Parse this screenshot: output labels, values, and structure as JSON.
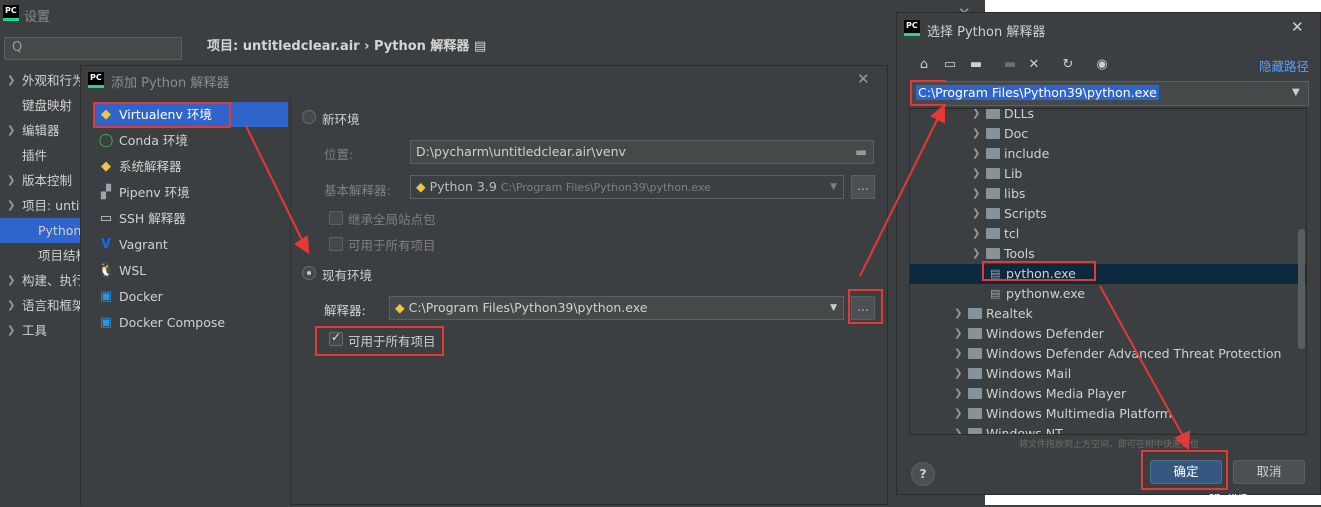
{
  "settings": {
    "title": "设置",
    "search_icon": "Q",
    "breadcrumb": "项目: untitledclear.air  ›  Python 解释器  ▤",
    "tree": [
      {
        "label": "外观和行为",
        "arrow": true
      },
      {
        "label": "键盘映射",
        "arrow": false
      },
      {
        "label": "编辑器",
        "arrow": true
      },
      {
        "label": "插件",
        "arrow": false
      },
      {
        "label": "版本控制",
        "arrow": true
      },
      {
        "label": "项目: untitledclear.air",
        "arrow": true
      },
      {
        "label": "Python 解释器",
        "arrow": false
      },
      {
        "label": "项目结构",
        "arrow": false
      },
      {
        "label": "构建、执行、部署",
        "arrow": true
      },
      {
        "label": "语言和框架",
        "arrow": true
      },
      {
        "label": "工具",
        "arrow": true
      }
    ]
  },
  "add_dialog": {
    "title": "添加 Python 解释器",
    "envs": [
      "Virtualenv 环境",
      "Conda 环境",
      "系统解释器",
      "Pipenv 环境",
      "SSH 解释器",
      "Vagrant",
      "WSL",
      "Docker",
      "Docker Compose"
    ],
    "new_env_label": "新环境",
    "location_label": "位置:",
    "location_value": "D:\\pycharm\\untitledclear.air\\venv",
    "base_interp_label": "基本解释器:",
    "base_interp_value": "Python 3.9",
    "base_interp_path": "C:\\Program Files\\Python39\\python.exe",
    "inherit_label": "继承全局站点包",
    "avail_all_label_1": "可用于所有项目",
    "existing_env_label": "现有环境",
    "interp_label": "解释器:",
    "interp_value": "C:\\Program Files\\Python39\\python.exe",
    "avail_all_label_2": "可用于所有项目",
    "browse": "..."
  },
  "chooser": {
    "title": "选择 Python 解释器",
    "hide_path": "隐藏路径",
    "path": "C:\\Program Files\\Python39\\python.exe",
    "nodes": [
      {
        "name": "DLLs",
        "type": "folder",
        "level": 1
      },
      {
        "name": "Doc",
        "type": "folder",
        "level": 1
      },
      {
        "name": "include",
        "type": "folder",
        "level": 1
      },
      {
        "name": "Lib",
        "type": "folder",
        "level": 1
      },
      {
        "name": "libs",
        "type": "folder",
        "level": 1
      },
      {
        "name": "Scripts",
        "type": "folder",
        "level": 1
      },
      {
        "name": "tcl",
        "type": "folder",
        "level": 1
      },
      {
        "name": "Tools",
        "type": "folder",
        "level": 1
      },
      {
        "name": "python.exe",
        "type": "file",
        "level": 1
      },
      {
        "name": "pythonw.exe",
        "type": "file",
        "level": 1
      },
      {
        "name": "Realtek",
        "type": "folder",
        "level": 0
      },
      {
        "name": "Windows Defender",
        "type": "folder",
        "level": 0
      },
      {
        "name": "Windows Defender Advanced Threat Protection",
        "type": "folder",
        "level": 0
      },
      {
        "name": "Windows Mail",
        "type": "folder",
        "level": 0
      },
      {
        "name": "Windows Media Player",
        "type": "folder",
        "level": 0
      },
      {
        "name": "Windows Multimedia Platform",
        "type": "folder",
        "level": 0
      },
      {
        "name": "Windows NT",
        "type": "folder",
        "level": 0
      }
    ],
    "drag_hint": "将文件拖放到上方空间，即可在树中快速定位",
    "help": "?",
    "ok": "确定",
    "cancel": "取消"
  },
  "watermark": "cn  .xyz"
}
